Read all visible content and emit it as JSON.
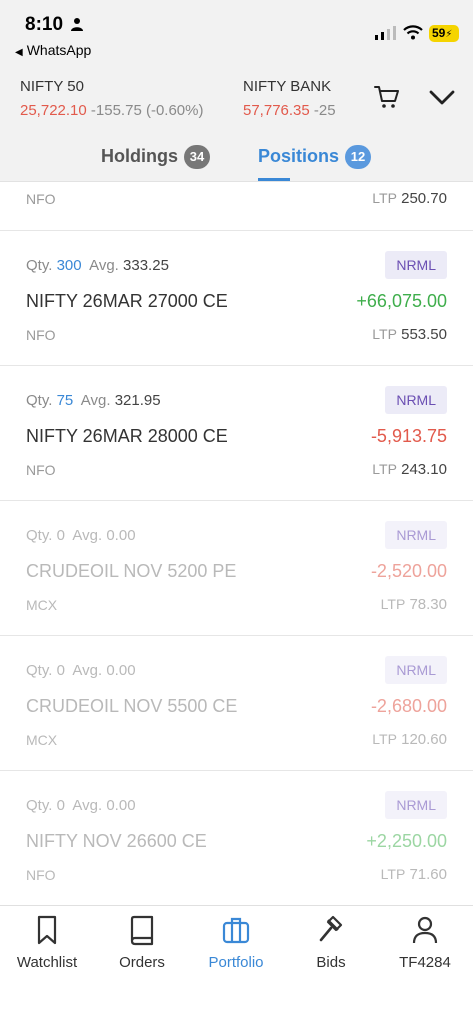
{
  "status": {
    "time": "8:10",
    "back_app": "WhatsApp",
    "battery": "59"
  },
  "indices": [
    {
      "name": "NIFTY 50",
      "value": "25,722.10",
      "change": "-155.75 (-0.60%)"
    },
    {
      "name": "NIFTY BANK",
      "value": "57,776.35",
      "change": "-25"
    }
  ],
  "tabs": {
    "holdings": {
      "label": "Holdings",
      "count": "34"
    },
    "positions": {
      "label": "Positions",
      "count": "12"
    }
  },
  "partial_row": {
    "exchange": "NFO",
    "ltp_label": "LTP",
    "ltp": "250.70"
  },
  "positions": [
    {
      "qty_label": "Qty.",
      "qty": "300",
      "avg_label": "Avg.",
      "avg": "333.25",
      "product": "NRML",
      "symbol": "NIFTY 26MAR 27000 CE",
      "pnl": "+66,075.00",
      "exchange": "NFO",
      "ltp_label": "LTP",
      "ltp": "553.50"
    },
    {
      "qty_label": "Qty.",
      "qty": "75",
      "avg_label": "Avg.",
      "avg": "321.95",
      "product": "NRML",
      "symbol": "NIFTY 26MAR 28000 CE",
      "pnl": "-5,913.75",
      "exchange": "NFO",
      "ltp_label": "LTP",
      "ltp": "243.10"
    },
    {
      "qty_label": "Qty.",
      "qty": "0",
      "avg_label": "Avg.",
      "avg": "0.00",
      "product": "NRML",
      "symbol": "CRUDEOIL NOV 5200 PE",
      "pnl": "-2,520.00",
      "exchange": "MCX",
      "ltp_label": "LTP",
      "ltp": "78.30"
    },
    {
      "qty_label": "Qty.",
      "qty": "0",
      "avg_label": "Avg.",
      "avg": "0.00",
      "product": "NRML",
      "symbol": "CRUDEOIL NOV 5500 CE",
      "pnl": "-2,680.00",
      "exchange": "MCX",
      "ltp_label": "LTP",
      "ltp": "120.60"
    },
    {
      "qty_label": "Qty.",
      "qty": "0",
      "avg_label": "Avg.",
      "avg": "0.00",
      "product": "NRML",
      "symbol": "NIFTY NOV 26600 CE",
      "pnl": "+2,250.00",
      "exchange": "NFO",
      "ltp_label": "LTP",
      "ltp": "71.60"
    }
  ],
  "nav": {
    "watchlist": "Watchlist",
    "orders": "Orders",
    "portfolio": "Portfolio",
    "bids": "Bids",
    "account": "TF4284"
  },
  "colors": {
    "accent": "#3a88d6",
    "profit": "#3fae4c",
    "loss": "#e25a4c",
    "product_badge": "#6b4fb3"
  }
}
